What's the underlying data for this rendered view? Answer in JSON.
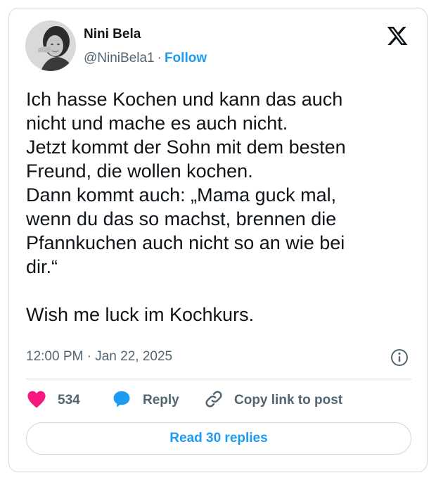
{
  "author": {
    "name": "Nini Bela",
    "handle": "@NiniBela1",
    "separator": "·",
    "follow_label": "Follow"
  },
  "tweet": {
    "text": "Ich hasse Kochen und kann das auch\nnicht und mache es auch nicht.\nJetzt kommt der Sohn mit dem besten\nFreund, die wollen kochen.\nDann kommt auch: „Mama guck mal,\nwenn du das so machst, brennen die\nPfannkuchen auch nicht so an wie bei\ndir.“\n\nWish me luck im Kochkurs.",
    "timestamp": "12:00 PM · Jan 22, 2025"
  },
  "actions": {
    "likes_count": "534",
    "reply_label": "Reply",
    "copy_link_label": "Copy link to post"
  },
  "read_replies_label": "Read 30 replies",
  "icons": {
    "brand": "x-logo-icon",
    "info": "info-icon",
    "like": "heart-icon",
    "reply": "speech-bubble-icon",
    "copy": "link-icon"
  },
  "colors": {
    "accent": "#1d9bf0",
    "like": "#f91880",
    "muted": "#536471",
    "border": "#cfd9de",
    "text": "#0f1419"
  }
}
